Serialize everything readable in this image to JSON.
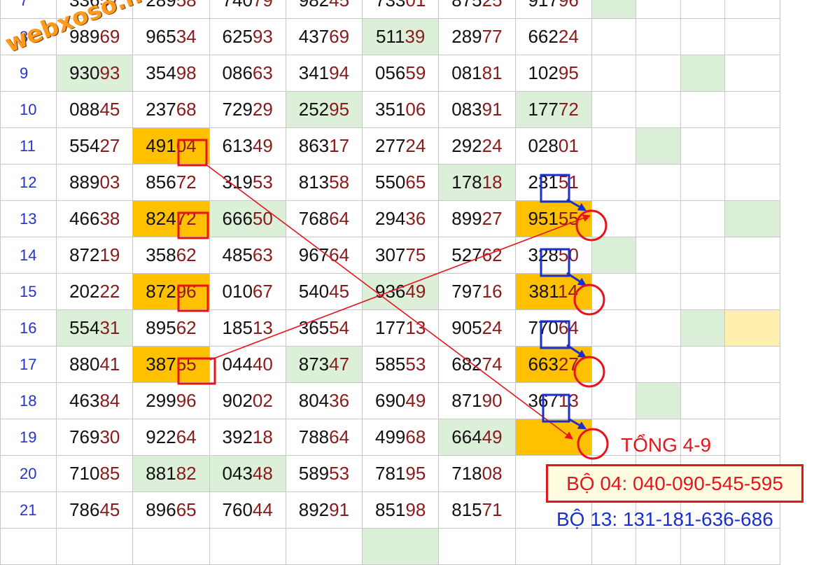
{
  "rows": [
    {
      "n": "7",
      "cells": [
        {
          "h": "336",
          "t": "57",
          "bg": ""
        },
        {
          "h": "289",
          "t": "58",
          "bg": ""
        },
        {
          "h": "740",
          "t": "79",
          "bg": ""
        },
        {
          "h": "982",
          "t": "45",
          "bg": ""
        },
        {
          "h": "733",
          "t": "01",
          "bg": ""
        },
        {
          "h": "875",
          "t": "25",
          "bg": ""
        },
        {
          "h": "917",
          "t": "96",
          "bg": ""
        }
      ],
      "extra": [
        "g",
        "",
        "",
        ""
      ]
    },
    {
      "n": "8",
      "cells": [
        {
          "h": "989",
          "t": "69",
          "bg": ""
        },
        {
          "h": "965",
          "t": "34",
          "bg": ""
        },
        {
          "h": "625",
          "t": "93",
          "bg": ""
        },
        {
          "h": "437",
          "t": "69",
          "bg": ""
        },
        {
          "h": "511",
          "t": "39",
          "bg": "g"
        },
        {
          "h": "289",
          "t": "77",
          "bg": ""
        },
        {
          "h": "662",
          "t": "24",
          "bg": ""
        }
      ],
      "extra": [
        "",
        "",
        "",
        ""
      ]
    },
    {
      "n": "9",
      "cells": [
        {
          "h": "930",
          "t": "93",
          "bg": "g"
        },
        {
          "h": "354",
          "t": "98",
          "bg": ""
        },
        {
          "h": "086",
          "t": "63",
          "bg": ""
        },
        {
          "h": "341",
          "t": "94",
          "bg": ""
        },
        {
          "h": "056",
          "t": "59",
          "bg": ""
        },
        {
          "h": "081",
          "t": "81",
          "bg": ""
        },
        {
          "h": "102",
          "t": "95",
          "bg": ""
        }
      ],
      "extra": [
        "",
        "",
        "g",
        ""
      ]
    },
    {
      "n": "10",
      "cells": [
        {
          "h": "088",
          "t": "45",
          "bg": ""
        },
        {
          "h": "237",
          "t": "68",
          "bg": ""
        },
        {
          "h": "729",
          "t": "29",
          "bg": ""
        },
        {
          "h": "252",
          "t": "95",
          "bg": "g"
        },
        {
          "h": "351",
          "t": "06",
          "bg": ""
        },
        {
          "h": "083",
          "t": "91",
          "bg": ""
        },
        {
          "h": "177",
          "t": "72",
          "bg": "g"
        }
      ],
      "extra": [
        "",
        "",
        "",
        ""
      ]
    },
    {
      "n": "11",
      "cells": [
        {
          "h": "554",
          "t": "27",
          "bg": ""
        },
        {
          "h": "491",
          "t": "04",
          "bg": "o"
        },
        {
          "h": "613",
          "t": "49",
          "bg": ""
        },
        {
          "h": "863",
          "t": "17",
          "bg": ""
        },
        {
          "h": "277",
          "t": "24",
          "bg": ""
        },
        {
          "h": "292",
          "t": "24",
          "bg": ""
        },
        {
          "h": "028",
          "t": "01",
          "bg": ""
        }
      ],
      "extra": [
        "",
        "g",
        "",
        ""
      ]
    },
    {
      "n": "12",
      "cells": [
        {
          "h": "889",
          "t": "03",
          "bg": ""
        },
        {
          "h": "856",
          "t": "72",
          "bg": ""
        },
        {
          "h": "319",
          "t": "53",
          "bg": ""
        },
        {
          "h": "813",
          "t": "58",
          "bg": ""
        },
        {
          "h": "550",
          "t": "65",
          "bg": ""
        },
        {
          "h": "178",
          "t": "18",
          "bg": "g"
        },
        {
          "h": "231",
          "t": "51",
          "bg": ""
        }
      ],
      "extra": [
        "",
        "",
        "",
        ""
      ]
    },
    {
      "n": "13",
      "cells": [
        {
          "h": "466",
          "t": "38",
          "bg": ""
        },
        {
          "h": "824",
          "t": "72",
          "bg": "o"
        },
        {
          "h": "666",
          "t": "50",
          "bg": "g"
        },
        {
          "h": "768",
          "t": "64",
          "bg": ""
        },
        {
          "h": "294",
          "t": "36",
          "bg": ""
        },
        {
          "h": "899",
          "t": "27",
          "bg": ""
        },
        {
          "h": "951",
          "t": "55",
          "bg": "o"
        }
      ],
      "extra": [
        "",
        "",
        "",
        "g"
      ]
    },
    {
      "n": "14",
      "cells": [
        {
          "h": "872",
          "t": "19",
          "bg": ""
        },
        {
          "h": "358",
          "t": "62",
          "bg": ""
        },
        {
          "h": "485",
          "t": "63",
          "bg": ""
        },
        {
          "h": "967",
          "t": "64",
          "bg": ""
        },
        {
          "h": "307",
          "t": "75",
          "bg": ""
        },
        {
          "h": "527",
          "t": "62",
          "bg": ""
        },
        {
          "h": "328",
          "t": "50",
          "bg": ""
        }
      ],
      "extra": [
        "g",
        "",
        "",
        ""
      ]
    },
    {
      "n": "15",
      "cells": [
        {
          "h": "202",
          "t": "22",
          "bg": ""
        },
        {
          "h": "872",
          "t": "96",
          "bg": "o"
        },
        {
          "h": "010",
          "t": "67",
          "bg": ""
        },
        {
          "h": "540",
          "t": "45",
          "bg": ""
        },
        {
          "h": "936",
          "t": "49",
          "bg": "g"
        },
        {
          "h": "797",
          "t": "16",
          "bg": ""
        },
        {
          "h": "381",
          "t": "14",
          "bg": "o"
        }
      ],
      "extra": [
        "",
        "",
        "",
        ""
      ]
    },
    {
      "n": "16",
      "cells": [
        {
          "h": "554",
          "t": "31",
          "bg": "g"
        },
        {
          "h": "895",
          "t": "62",
          "bg": ""
        },
        {
          "h": "185",
          "t": "13",
          "bg": ""
        },
        {
          "h": "365",
          "t": "54",
          "bg": ""
        },
        {
          "h": "177",
          "t": "13",
          "bg": ""
        },
        {
          "h": "905",
          "t": "24",
          "bg": ""
        },
        {
          "h": "770",
          "t": "64",
          "bg": ""
        }
      ],
      "extra": [
        "",
        "",
        "g",
        "y"
      ]
    },
    {
      "n": "17",
      "cells": [
        {
          "h": "880",
          "t": "41",
          "bg": ""
        },
        {
          "h": "387",
          "t": "55",
          "bg": "o"
        },
        {
          "h": "044",
          "t": "40",
          "bg": ""
        },
        {
          "h": "873",
          "t": "47",
          "bg": "g"
        },
        {
          "h": "585",
          "t": "53",
          "bg": ""
        },
        {
          "h": "682",
          "t": "74",
          "bg": ""
        },
        {
          "h": "663",
          "t": "27",
          "bg": "o"
        }
      ],
      "extra": [
        "",
        "",
        "",
        ""
      ]
    },
    {
      "n": "18",
      "cells": [
        {
          "h": "463",
          "t": "84",
          "bg": ""
        },
        {
          "h": "299",
          "t": "96",
          "bg": ""
        },
        {
          "h": "902",
          "t": "02",
          "bg": ""
        },
        {
          "h": "804",
          "t": "36",
          "bg": ""
        },
        {
          "h": "690",
          "t": "49",
          "bg": ""
        },
        {
          "h": "871",
          "t": "90",
          "bg": ""
        },
        {
          "h": "367",
          "t": "13",
          "bg": ""
        }
      ],
      "extra": [
        "",
        "g",
        "",
        ""
      ]
    },
    {
      "n": "19",
      "cells": [
        {
          "h": "769",
          "t": "30",
          "bg": ""
        },
        {
          "h": "922",
          "t": "64",
          "bg": ""
        },
        {
          "h": "392",
          "t": "18",
          "bg": ""
        },
        {
          "h": "788",
          "t": "64",
          "bg": ""
        },
        {
          "h": "499",
          "t": "68",
          "bg": ""
        },
        {
          "h": "664",
          "t": "49",
          "bg": "g"
        },
        {
          "h": "",
          "t": "",
          "bg": "o"
        }
      ],
      "extra": [
        "",
        "",
        "",
        ""
      ]
    },
    {
      "n": "20",
      "cells": [
        {
          "h": "710",
          "t": "85",
          "bg": ""
        },
        {
          "h": "881",
          "t": "82",
          "bg": "g"
        },
        {
          "h": "043",
          "t": "48",
          "bg": "g"
        },
        {
          "h": "589",
          "t": "53",
          "bg": ""
        },
        {
          "h": "781",
          "t": "95",
          "bg": ""
        },
        {
          "h": "718",
          "t": "08",
          "bg": ""
        },
        {
          "h": "",
          "t": "",
          "bg": ""
        }
      ],
      "extra": [
        "",
        "",
        "",
        ""
      ]
    },
    {
      "n": "21",
      "cells": [
        {
          "h": "786",
          "t": "45",
          "bg": ""
        },
        {
          "h": "896",
          "t": "65",
          "bg": ""
        },
        {
          "h": "760",
          "t": "44",
          "bg": ""
        },
        {
          "h": "892",
          "t": "91",
          "bg": ""
        },
        {
          "h": "851",
          "t": "98",
          "bg": ""
        },
        {
          "h": "815",
          "t": "71",
          "bg": ""
        },
        {
          "h": "",
          "t": "",
          "bg": ""
        }
      ],
      "extra": [
        "",
        "",
        "",
        ""
      ]
    },
    {
      "n": "",
      "cells": [
        {
          "h": "",
          "t": "",
          "bg": ""
        },
        {
          "h": "",
          "t": "",
          "bg": ""
        },
        {
          "h": "",
          "t": "",
          "bg": ""
        },
        {
          "h": "",
          "t": "",
          "bg": ""
        },
        {
          "h": "",
          "t": "",
          "bg": "g"
        },
        {
          "h": "",
          "t": "",
          "bg": ""
        },
        {
          "h": "",
          "t": "",
          "bg": ""
        }
      ],
      "extra": [
        "",
        "",
        "",
        ""
      ]
    }
  ],
  "annotations": {
    "tong": "TỔNG 4-9",
    "bo_04": "BỘ 04: 040-090-545-595",
    "bo_13": "BỘ 13: 131-181-636-686"
  },
  "watermark": "webxoso.net",
  "colors": {
    "row_number": "#2633cc",
    "head_digits": "#111111",
    "tail_digits": "#8b1a1a",
    "green_fill": "#dcefd8",
    "orange_fill": "#ffc000",
    "red_mark": "#e8141c",
    "blue_mark": "#1a2fd1",
    "watermark": "#ff9a1a"
  }
}
